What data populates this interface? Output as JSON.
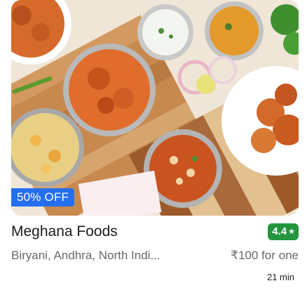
{
  "restaurant": {
    "name": "Meghana Foods",
    "rating": "4.4",
    "rating_icon": "star-icon",
    "cuisines": "Biryani, Andhra, North Indi...",
    "price": "₹100 for one",
    "delivery_time": "21 min",
    "offer": "50% OFF"
  },
  "colors": {
    "offer_badge": "#256fef",
    "rating_badge": "#24963f",
    "title_text": "#1c1c1c",
    "secondary_text": "#696969"
  }
}
